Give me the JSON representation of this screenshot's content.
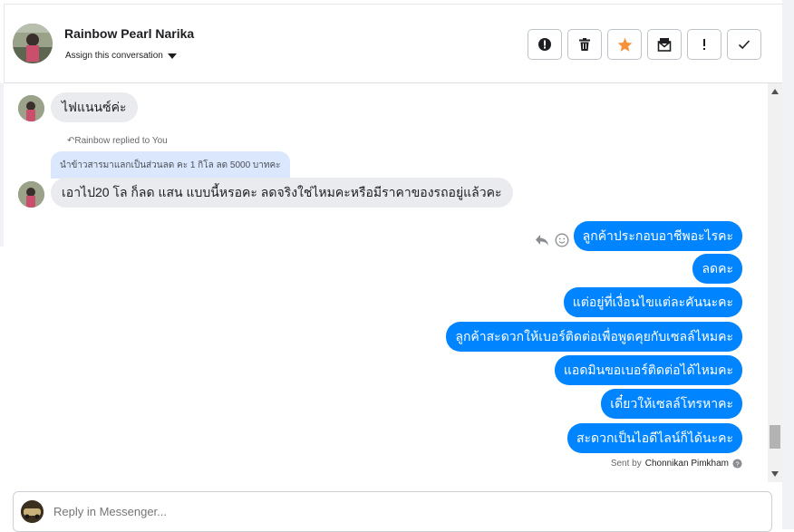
{
  "header": {
    "contact_name": "Rainbow Pearl Narika",
    "assign_label": "Assign this conversation",
    "actions": [
      {
        "name": "mark-spam-button",
        "icon": "alert-circle-icon"
      },
      {
        "name": "delete-button",
        "icon": "trash-icon"
      },
      {
        "name": "star-button",
        "icon": "star-icon",
        "color": "#f7923a"
      },
      {
        "name": "mark-unread-button",
        "icon": "envelope-icon"
      },
      {
        "name": "follow-up-button",
        "icon": "exclamation-icon"
      },
      {
        "name": "mark-done-button",
        "icon": "checkmark-icon"
      }
    ]
  },
  "conversation": {
    "incoming": [
      {
        "text": "ไฟแนนซ์ค่ะ"
      },
      {
        "text": "เอาไป20 โล ก็ลด แสน แบบนี้หรอคะ ลดจริงใช่ไหมคะหรือมีราคาของรถอยู่แล้วคะ"
      }
    ],
    "reply_note": "Rainbow replied to You",
    "quoted_text": "นำข้าวสารมาแลกเป็นส่วนลด คะ 1 กิโล ลด 5000 บาทคะ",
    "outgoing": [
      {
        "text": "ลูกค้าประกอบอาชีพอะไรคะ"
      },
      {
        "text": "ลดคะ"
      },
      {
        "text": "แต่อยู่ที่เงื่อนไขแต่ละคันนะคะ"
      },
      {
        "text": "ลูกค้าสะดวกให้เบอร์ติดต่อเพื่อพูดคุยกับเซลล์ไหมคะ"
      },
      {
        "text": "แอดมินขอเบอร์ติดต่อได้ไหมคะ"
      },
      {
        "text": "เดี๋ยวให้เซลล์โทรหาคะ"
      },
      {
        "text": "สะดวกเป็นไอดีไลน์ก็ได้นะคะ"
      }
    ],
    "sent_by_prefix": "Sent by",
    "sent_by_name": "Chonnikan Pimkham"
  },
  "composer": {
    "placeholder": "Reply in Messenger..."
  },
  "colors": {
    "outgoing_bubble": "#0084ff",
    "incoming_bubble": "#e9ebee",
    "quote_bubble": "#dbe7fc",
    "star": "#f7923a"
  }
}
